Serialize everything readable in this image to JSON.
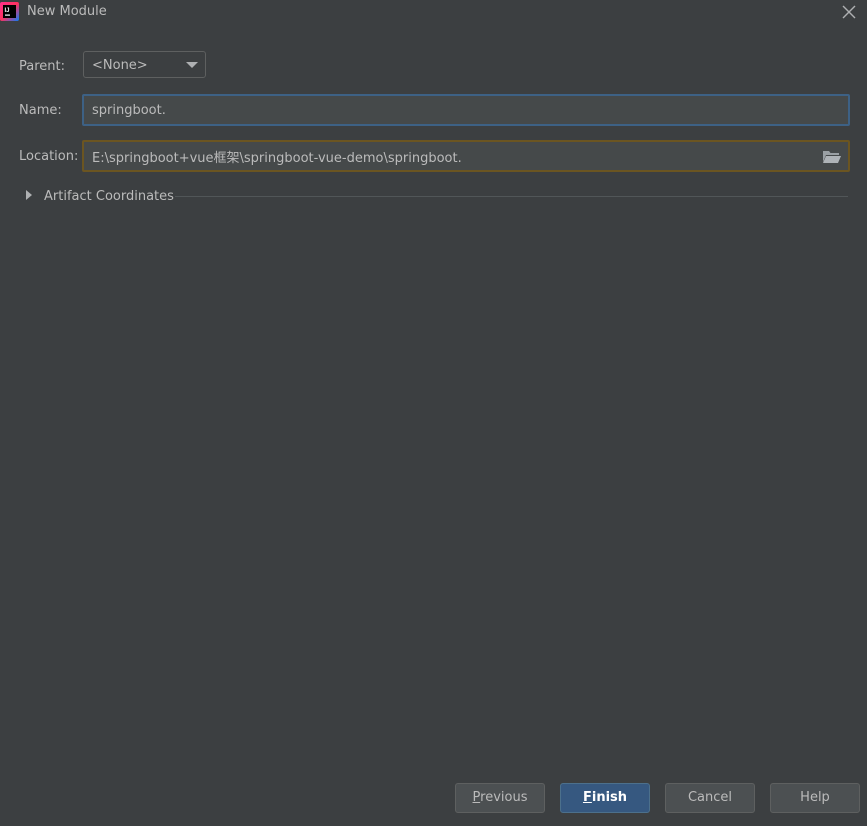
{
  "window": {
    "title": "New Module",
    "logo_icon": "intellij-idea-icon",
    "close_icon": "close-icon"
  },
  "form": {
    "parent": {
      "label": "Parent:",
      "value": "<None>"
    },
    "name": {
      "label": "Name:",
      "value": "springboot."
    },
    "location": {
      "label": "Location:",
      "value": "E:\\springboot+vue框架\\springboot-vue-demo\\springboot.",
      "browse_icon": "folder-icon"
    }
  },
  "artifact_section": {
    "label": "Artifact Coordinates",
    "expanded": false
  },
  "buttons": {
    "previous": "Previous",
    "finish": "Finish",
    "cancel": "Cancel",
    "help": "Help"
  },
  "colors": {
    "background": "#3c3f41",
    "name_focus_border": "#3d6185",
    "location_warning_border": "#6b5521",
    "primary_button": "#365880"
  }
}
